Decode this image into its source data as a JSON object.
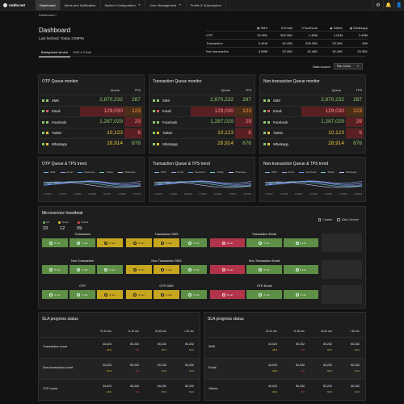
{
  "colors": {
    "green": "#8ec76a",
    "yellow": "#e8c23a",
    "orange": "#ff9a4a",
    "red_bg": "#5a1f22",
    "red_text": "#ff8f8f"
  },
  "nav": {
    "logo": "noble.net",
    "items": [
      {
        "label": "Dashboard",
        "active": true,
        "has_menu": false
      },
      {
        "label": "Alerts and Notification",
        "active": false,
        "has_menu": false
      },
      {
        "label": "System Configuration",
        "active": false,
        "has_menu": true
      },
      {
        "label": "User Management",
        "active": false,
        "has_menu": true
      },
      {
        "label": "Profile & Subscription",
        "active": false,
        "has_menu": false
      }
    ],
    "icons": [
      "settings-icon",
      "bell-icon",
      "user-icon"
    ]
  },
  "breadcrumb": "Dashboard /",
  "header": {
    "title": "Dashboard",
    "last_fetched": "Last fetched: Today 3:09PM",
    "tabs": [
      {
        "label": "Background service",
        "active": true
      },
      {
        "label": "SMS & Email",
        "active": false
      }
    ]
  },
  "summary": {
    "columns": [
      "SMS",
      "Email",
      "Facebook",
      "Twitter",
      "Whatsapp"
    ],
    "rows": [
      {
        "label": "OTP",
        "values": [
          "32.30K",
          "900.30K",
          "1.49M",
          "1.01M",
          "1.49M"
        ]
      },
      {
        "label": "Transaction",
        "values": [
          "3.41M",
          "42.43K",
          "209.29K",
          "23.32K",
          "900"
        ]
      },
      {
        "label": "Non-transaction",
        "values": [
          "3.69M",
          "23.32K",
          "42.43K",
          "42.43K",
          "23.32K"
        ]
      }
    ]
  },
  "data_source": {
    "label": "Data source:",
    "value": "Pan Cuba"
  },
  "queues": [
    {
      "title": "OTP Queue monitor",
      "head_queue": "Queue",
      "head_tps": "TPS",
      "rows": [
        {
          "name": "SMS",
          "queue": "2,870,232",
          "tps": "287",
          "q_state": "green",
          "t_state": "green"
        },
        {
          "name": "Email",
          "queue": "129,030",
          "tps": "123",
          "q_state": "red",
          "t_state": "orange"
        },
        {
          "name": "Facebook",
          "queue": "1,287,029",
          "tps": "29",
          "q_state": "green",
          "t_state": "red"
        },
        {
          "name": "Twitter",
          "queue": "10,123",
          "tps": "6",
          "q_state": "yellow",
          "t_state": "red"
        },
        {
          "name": "Whatsapp",
          "queue": "28,914",
          "tps": "876",
          "q_state": "yellow",
          "t_state": "green"
        }
      ]
    },
    {
      "title": "Transaction Queue monitor",
      "head_queue": "Queue",
      "head_tps": "TPS",
      "rows": [
        {
          "name": "SMS",
          "queue": "2,870,232",
          "tps": "287",
          "q_state": "green",
          "t_state": "green"
        },
        {
          "name": "Email",
          "queue": "129,030",
          "tps": "123",
          "q_state": "red",
          "t_state": "orange"
        },
        {
          "name": "Facebook",
          "queue": "1,287,029",
          "tps": "29",
          "q_state": "green",
          "t_state": "red"
        },
        {
          "name": "Twitter",
          "queue": "10,123",
          "tps": "6",
          "q_state": "yellow",
          "t_state": "red"
        },
        {
          "name": "Whatsapp",
          "queue": "28,914",
          "tps": "876",
          "q_state": "yellow",
          "t_state": "green"
        }
      ]
    },
    {
      "title": "Non-transaction Queue monitor",
      "head_queue": "Queue",
      "head_tps": "TPS",
      "rows": [
        {
          "name": "SMS",
          "queue": "2,870,232",
          "tps": "287",
          "q_state": "green",
          "t_state": "green"
        },
        {
          "name": "Email",
          "queue": "129,030",
          "tps": "123",
          "q_state": "red",
          "t_state": "orange"
        },
        {
          "name": "Facebook",
          "queue": "1,287,029",
          "tps": "29",
          "q_state": "green",
          "t_state": "red"
        },
        {
          "name": "Twitter",
          "queue": "10,123",
          "tps": "6",
          "q_state": "yellow",
          "t_state": "red"
        },
        {
          "name": "Whatsapp",
          "queue": "28,914",
          "tps": "876",
          "q_state": "yellow",
          "t_state": "green"
        }
      ]
    }
  ],
  "trends": [
    {
      "title": "OTP Queue & TPS trend"
    },
    {
      "title": "Transaction Queue & TPS trend"
    },
    {
      "title": "Non-transaction Queue & TPS trend"
    }
  ],
  "trend_legend": [
    {
      "name": "SMS",
      "color": "#8ab4ff"
    },
    {
      "name": "Email",
      "color": "#a99cff"
    },
    {
      "name": "Facebook",
      "color": "#5fa3ff"
    },
    {
      "name": "Twitter",
      "color": "#6fd0d0"
    },
    {
      "name": "Whatsapp",
      "color": "#c8c8ff"
    }
  ],
  "trend_ticks": [
    "14:00PM",
    "14:10PM",
    "14:20PM",
    "14:30PM",
    "14:40PM",
    "14:50PM",
    "15:00PM"
  ],
  "heartbeat": {
    "title": "Microservice heartbeat",
    "legend": [
      {
        "label": "OK",
        "value": "23",
        "color": "#6cbf5a"
      },
      {
        "label": "Check",
        "value": "12",
        "color": "#e8c23a"
      },
      {
        "label": "Critical",
        "value": "09",
        "color": "#e0465f"
      }
    ],
    "options": [
      "Crawler",
      "Micro Service"
    ],
    "groups": [
      {
        "title": "Transaction",
        "chips": [
          {
            "state": "green",
            "label": "5 min"
          },
          {
            "state": "green",
            "label": "5 min"
          },
          {
            "state": "yellow",
            "label": "5 min"
          }
        ]
      },
      {
        "title": "Transaction SMS",
        "chips": [
          {
            "state": "yellow",
            "label": "5 min"
          },
          {
            "state": "yellow",
            "label": "5 min"
          },
          {
            "state": "green",
            "label": "5 min"
          }
        ]
      },
      {
        "title": "Transaction Email",
        "chips": [
          {
            "state": "red",
            "label": "5 min"
          },
          {
            "state": "green",
            "label": "5 min"
          },
          {
            "state": "green",
            "label": "5 min"
          }
        ]
      },
      {
        "title": "",
        "chips": []
      },
      {
        "title": "Non-Transaction",
        "chips": [
          {
            "state": "green",
            "label": "5 min"
          },
          {
            "state": "green",
            "label": "5 min"
          },
          {
            "state": "green",
            "label": "5 min"
          }
        ]
      },
      {
        "title": "Non-Transaction SMS",
        "chips": [
          {
            "state": "yellow",
            "label": "5 min"
          },
          {
            "state": "yellow",
            "label": "5 min"
          },
          {
            "state": "green",
            "label": "5 min"
          }
        ]
      },
      {
        "title": "Non-Transaction Email",
        "chips": [
          {
            "state": "red",
            "label": "5 min"
          },
          {
            "state": "green",
            "label": "5 min"
          },
          {
            "state": "green",
            "label": "5 min"
          }
        ]
      },
      {
        "title": "",
        "chips": []
      },
      {
        "title": "OTP",
        "chips": [
          {
            "state": "green",
            "label": "5 min"
          },
          {
            "state": "green",
            "label": "5 min"
          },
          {
            "state": "yellow",
            "label": "5 min"
          }
        ]
      },
      {
        "title": "OTP-SMS",
        "chips": [
          {
            "state": "yellow",
            "label": "5 min"
          },
          {
            "state": "yellow",
            "label": "5 min"
          },
          {
            "state": "green",
            "label": "5 min"
          }
        ]
      },
      {
        "title": "OTP-Email",
        "chips": [
          {
            "state": "red",
            "label": "5 min"
          },
          {
            "state": "green",
            "label": "5 min"
          },
          {
            "state": "green",
            "label": "5 min"
          }
        ]
      },
      {
        "title": "",
        "chips": []
      }
    ]
  },
  "sla": [
    {
      "title": "SLA progress status",
      "columns": [
        "00-10 sec",
        "11-30 sec",
        "30-60 sec",
        "> 60 sec"
      ],
      "rows": [
        {
          "label": "Transaction count",
          "values": [
            "34,023",
            "50,232",
            "50,232",
            "50,232"
          ],
          "pcts": [
            "34%",
            "0%",
            "80%",
            "62%"
          ]
        },
        {
          "label": "Non-transaction count",
          "values": [
            "34,023",
            "50,232",
            "50,232",
            "50,232"
          ],
          "pcts": [
            "34%",
            "0%",
            "80%",
            "62%"
          ]
        },
        {
          "label": "OTP count",
          "values": [
            "34,023",
            "50,232",
            "50,232",
            "50,232"
          ],
          "pcts": [
            "34%",
            "0%",
            "80%",
            "62%"
          ]
        }
      ]
    },
    {
      "title": "SLA progress status",
      "columns": [
        "00-10 sec",
        "11-30 sec",
        "30-60 sec",
        "> 60 sec"
      ],
      "rows": [
        {
          "label": "SMS",
          "values": [
            "34,023",
            "50,232",
            "50,232",
            "50,232"
          ],
          "pcts": [
            "34%",
            "0%",
            "80%",
            "62%"
          ]
        },
        {
          "label": "Email",
          "values": [
            "34,023",
            "50,232",
            "50,232",
            "50,232"
          ],
          "pcts": [
            "34%",
            "0%",
            "80%",
            "62%"
          ]
        },
        {
          "label": "Others",
          "values": [
            "34,023",
            "50,232",
            "50,232",
            "50,232"
          ],
          "pcts": [
            "34%",
            "0%",
            "80%",
            "62%"
          ]
        }
      ]
    }
  ],
  "sla_pct_colors": [
    "#e8c23a",
    "#e0465f",
    "#8ec76a",
    "#8ec76a"
  ]
}
